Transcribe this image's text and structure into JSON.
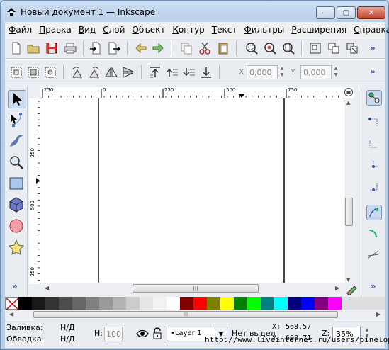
{
  "window": {
    "title": "Новый документ 1 — Inkscape",
    "controls": {
      "minimize": "—",
      "maximize": "▢",
      "close": "✕"
    }
  },
  "menu": [
    "Файл",
    "Правка",
    "Вид",
    "Слой",
    "Объект",
    "Контур",
    "Текст",
    "Фильтры",
    "Расширения",
    "Справка"
  ],
  "toolbar_main": {
    "icons": [
      "new-document-icon",
      "open-icon",
      "save-icon",
      "print-icon",
      "import-icon",
      "export-icon",
      "undo-icon",
      "redo-icon",
      "duplicate-icon",
      "cut-icon",
      "paste-icon",
      "zoom-selection-icon",
      "zoom-drawing-icon",
      "zoom-page-icon",
      "group-icon",
      "ungroup-icon",
      "clone-icon"
    ],
    "more": "»"
  },
  "toolbar_select": {
    "icons": [
      "select-all-icon",
      "select-all-layers-icon",
      "deselect-icon",
      "rotate-ccw-icon",
      "rotate-cw-icon",
      "flip-horizontal-icon",
      "flip-vertical-icon",
      "raise-to-top-icon",
      "raise-icon",
      "lower-icon",
      "lower-to-bottom-icon"
    ],
    "x_label": "X",
    "x_value": "0,000",
    "y_label": "Y",
    "y_value": "0,000",
    "more": "»"
  },
  "tools": [
    "selector-icon",
    "node-icon",
    "tweak-icon",
    "zoom-icon",
    "rectangle-icon",
    "3dbox-icon",
    "ellipse-icon",
    "star-icon"
  ],
  "tools_more": "»",
  "rulers": {
    "horizontal": [
      "250",
      "0",
      "250",
      "500",
      "750"
    ],
    "vertical": [
      "250",
      "500",
      "250"
    ]
  },
  "snap_tools_more": "»",
  "palette": {
    "colors": [
      "#000000",
      "#1a1a1a",
      "#333333",
      "#4d4d4d",
      "#666666",
      "#808080",
      "#999999",
      "#b3b3b3",
      "#cccccc",
      "#e6e6e6",
      "#f2f2f2",
      "#ffffff",
      "#800000",
      "#ff0000",
      "#808000",
      "#ffff00",
      "#008000",
      "#00ff00",
      "#008080",
      "#00ffff",
      "#000080",
      "#0000ff",
      "#800080",
      "#ff00ff"
    ]
  },
  "status": {
    "fill_label": "Заливка:",
    "fill_value": "Н/Д",
    "stroke_label": "Обводка:",
    "stroke_value": "Н/Д",
    "opacity_label": "H:",
    "opacity_value": "100",
    "layer": "•Layer 1",
    "message": "Нет выдел",
    "x_label": "X:",
    "x_value": "568,57",
    "y_label": "Y:",
    "y_value": "608,71",
    "zoom_label": "Z:",
    "zoom_value": "35%"
  },
  "watermark": "http://www.liveinternet.ru/users/pinelopa/"
}
